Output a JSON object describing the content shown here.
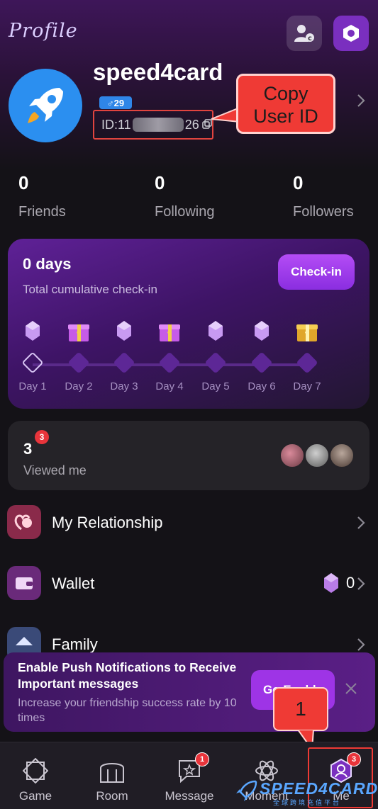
{
  "header": {
    "title": "Profile",
    "username": "speed4card",
    "gender_age": "♂29",
    "user_id_prefix": "ID:11",
    "user_id_suffix": "26",
    "icons": [
      "add-user-icon",
      "settings-hexagon-icon",
      "copy-icon",
      "chevron-right-icon"
    ]
  },
  "annotation": {
    "copy_callout": "Copy\nUser ID",
    "step_number": "1",
    "color": "#ef3a35"
  },
  "stats": [
    {
      "count": "0",
      "label": "Friends"
    },
    {
      "count": "0",
      "label": "Following"
    },
    {
      "count": "0",
      "label": "Followers"
    }
  ],
  "checkin": {
    "days_text": "0 days",
    "subtitle": "Total cumulative check-in",
    "button": "Check-in",
    "days": [
      {
        "label": "Day 1",
        "reward": "gem"
      },
      {
        "label": "Day 2",
        "reward": "gift"
      },
      {
        "label": "Day 3",
        "reward": "gem"
      },
      {
        "label": "Day 4",
        "reward": "gift"
      },
      {
        "label": "Day 5",
        "reward": "gem"
      },
      {
        "label": "Day 6",
        "reward": "gem"
      },
      {
        "label": "Day 7",
        "reward": "gold-gift"
      }
    ]
  },
  "viewed": {
    "count": "3",
    "badge": "3",
    "label": "Viewed me"
  },
  "menu": {
    "relationship": "My Relationship",
    "wallet": "Wallet",
    "wallet_value": "0",
    "family": "Family"
  },
  "push_banner": {
    "title": "Enable Push Notifications to Receive Important messages",
    "subtitle": "Increase your friendship success rate by 10 times",
    "button": "Go Enable"
  },
  "nav": {
    "items": [
      {
        "label": "Game",
        "badge": ""
      },
      {
        "label": "Room",
        "badge": ""
      },
      {
        "label": "Message",
        "badge": "1"
      },
      {
        "label": "Moment",
        "badge": ""
      },
      {
        "label": "Me",
        "badge": "3"
      }
    ]
  },
  "watermark": {
    "brand": "SPEED4CARD",
    "tagline": "全球跨境充值平台"
  },
  "colors": {
    "background": "#141217",
    "accent": "#9e34e6",
    "card": "#252328",
    "badge": "#e8343b"
  }
}
